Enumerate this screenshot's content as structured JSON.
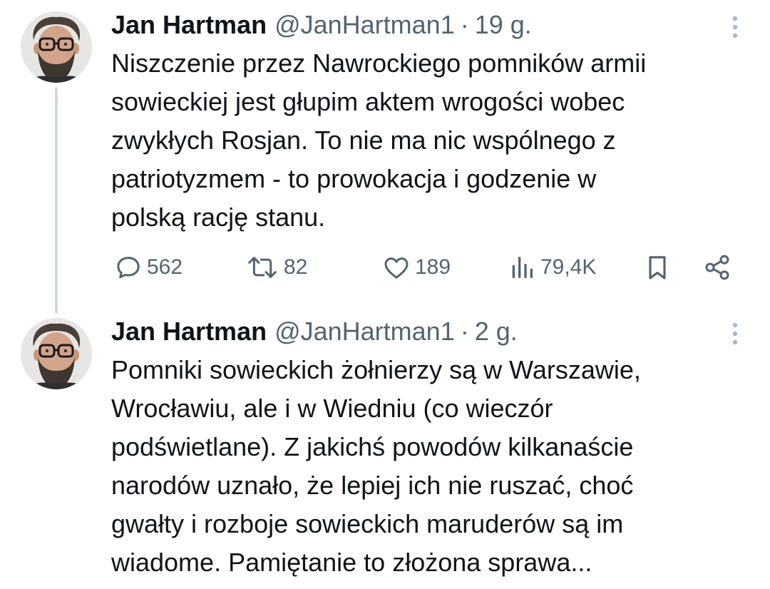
{
  "tweets": [
    {
      "author_name": "Jan Hartman",
      "author_handle": "@JanHartman1",
      "separator": "·",
      "time": "19 g.",
      "text_lines": [
        "Niszczenie przez Nawrockiego pomników armii",
        "sowieckiej jest głupim aktem wrogości wobec",
        "zwykłych Rosjan. To nie ma nic wspólnego z",
        "patriotyzmem - to prowokacja i godzenie w",
        "polską rację stanu."
      ],
      "actions": {
        "reply_count": "562",
        "retweet_count": "82",
        "like_count": "189",
        "views_count": "79,4K"
      }
    },
    {
      "author_name": "Jan Hartman",
      "author_handle": "@JanHartman1",
      "separator": "·",
      "time": "2 g.",
      "text_lines": [
        "Pomniki sowieckich żołnierzy są w Warszawie,",
        "Wrocławiu, ale i w Wiedniu (co wieczór",
        "podświetlane). Z jakichś powodów kilkanaście",
        "narodów uznało, że lepiej ich nie ruszać, choć",
        "gwałty i rozboje sowieckich maruderów są im",
        "wiadome. Pamiętanie to złożona sprawa..."
      ]
    }
  ],
  "icons": {
    "reply": "speech-bubble-icon",
    "retweet": "retweet-icon",
    "like": "heart-icon",
    "views": "bar-chart-icon",
    "bookmark": "bookmark-icon",
    "share": "share-icon",
    "more": "vertical-dots-icon"
  },
  "colors": {
    "text_primary": "#0f1419",
    "text_secondary": "#536471",
    "thread_line": "#cfd9de",
    "background": "#ffffff"
  }
}
